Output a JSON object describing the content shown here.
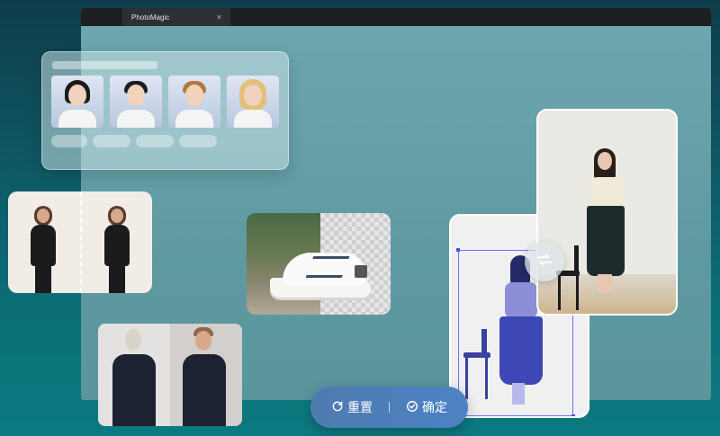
{
  "app": {
    "tab_title": "PhotoMagic",
    "tab_close": "×"
  },
  "avatars": {
    "hair_colors": [
      "#1a1a1a",
      "#1b1b22",
      "#b07a3c",
      "#e2c07a"
    ]
  },
  "actions": {
    "reset_label": "重置",
    "confirm_label": "确定"
  },
  "icons": {
    "reset": "refresh-icon",
    "confirm": "check-circle-icon",
    "swap": "swap-arrows-icon",
    "close": "close-icon"
  }
}
